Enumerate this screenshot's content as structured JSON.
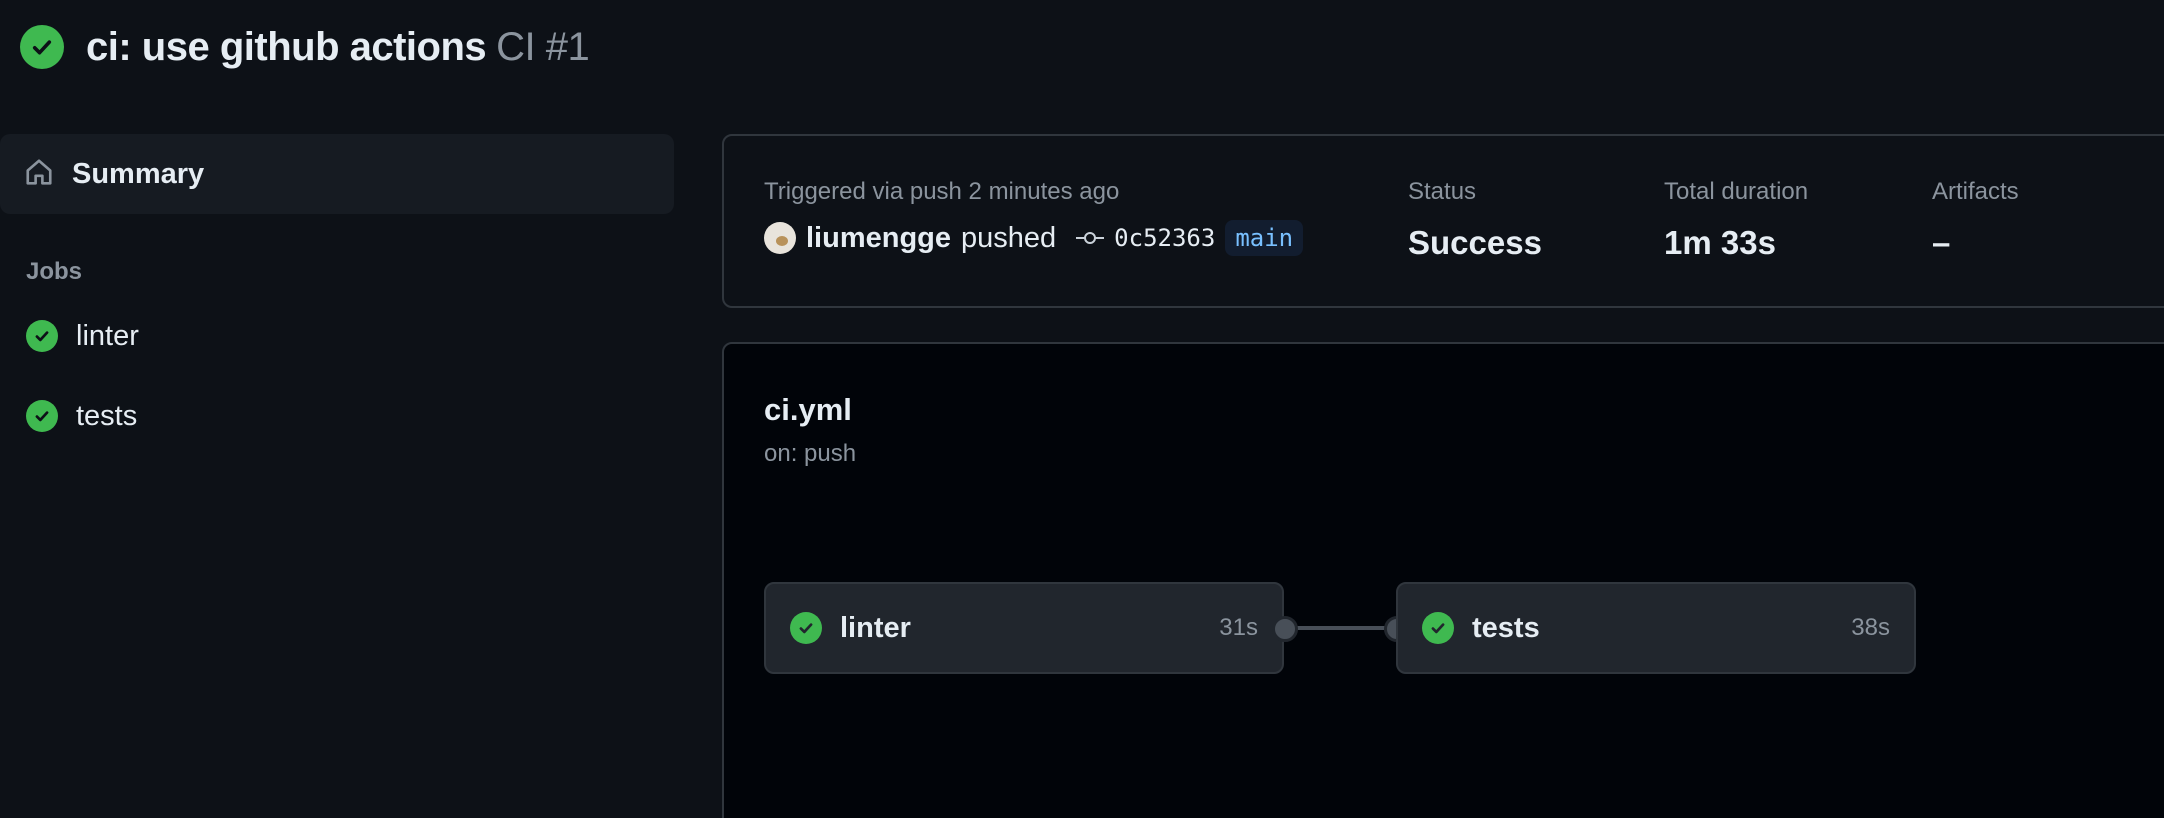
{
  "header": {
    "title": "ci: use github actions",
    "workflow_run": "CI #1",
    "status_icon": "check-circle-icon"
  },
  "sidebar": {
    "summary_label": "Summary",
    "jobs_heading": "Jobs",
    "jobs": [
      {
        "label": "linter"
      },
      {
        "label": "tests"
      }
    ]
  },
  "summary": {
    "trigger_text": "Triggered via push 2 minutes ago",
    "user": "liumengge",
    "action": "pushed",
    "commit_sha": "0c52363",
    "branch": "main",
    "status_label": "Status",
    "status_value": "Success",
    "duration_label": "Total duration",
    "duration_value": "1m 33s",
    "artifacts_label": "Artifacts",
    "artifacts_value": "–"
  },
  "graph": {
    "file": "ci.yml",
    "on": "on: push",
    "jobs": [
      {
        "name": "linter",
        "duration": "31s"
      },
      {
        "name": "tests",
        "duration": "38s"
      }
    ]
  },
  "colors": {
    "success": "#3fb950",
    "background": "#0d1117",
    "branch_text": "#79c0ff"
  }
}
